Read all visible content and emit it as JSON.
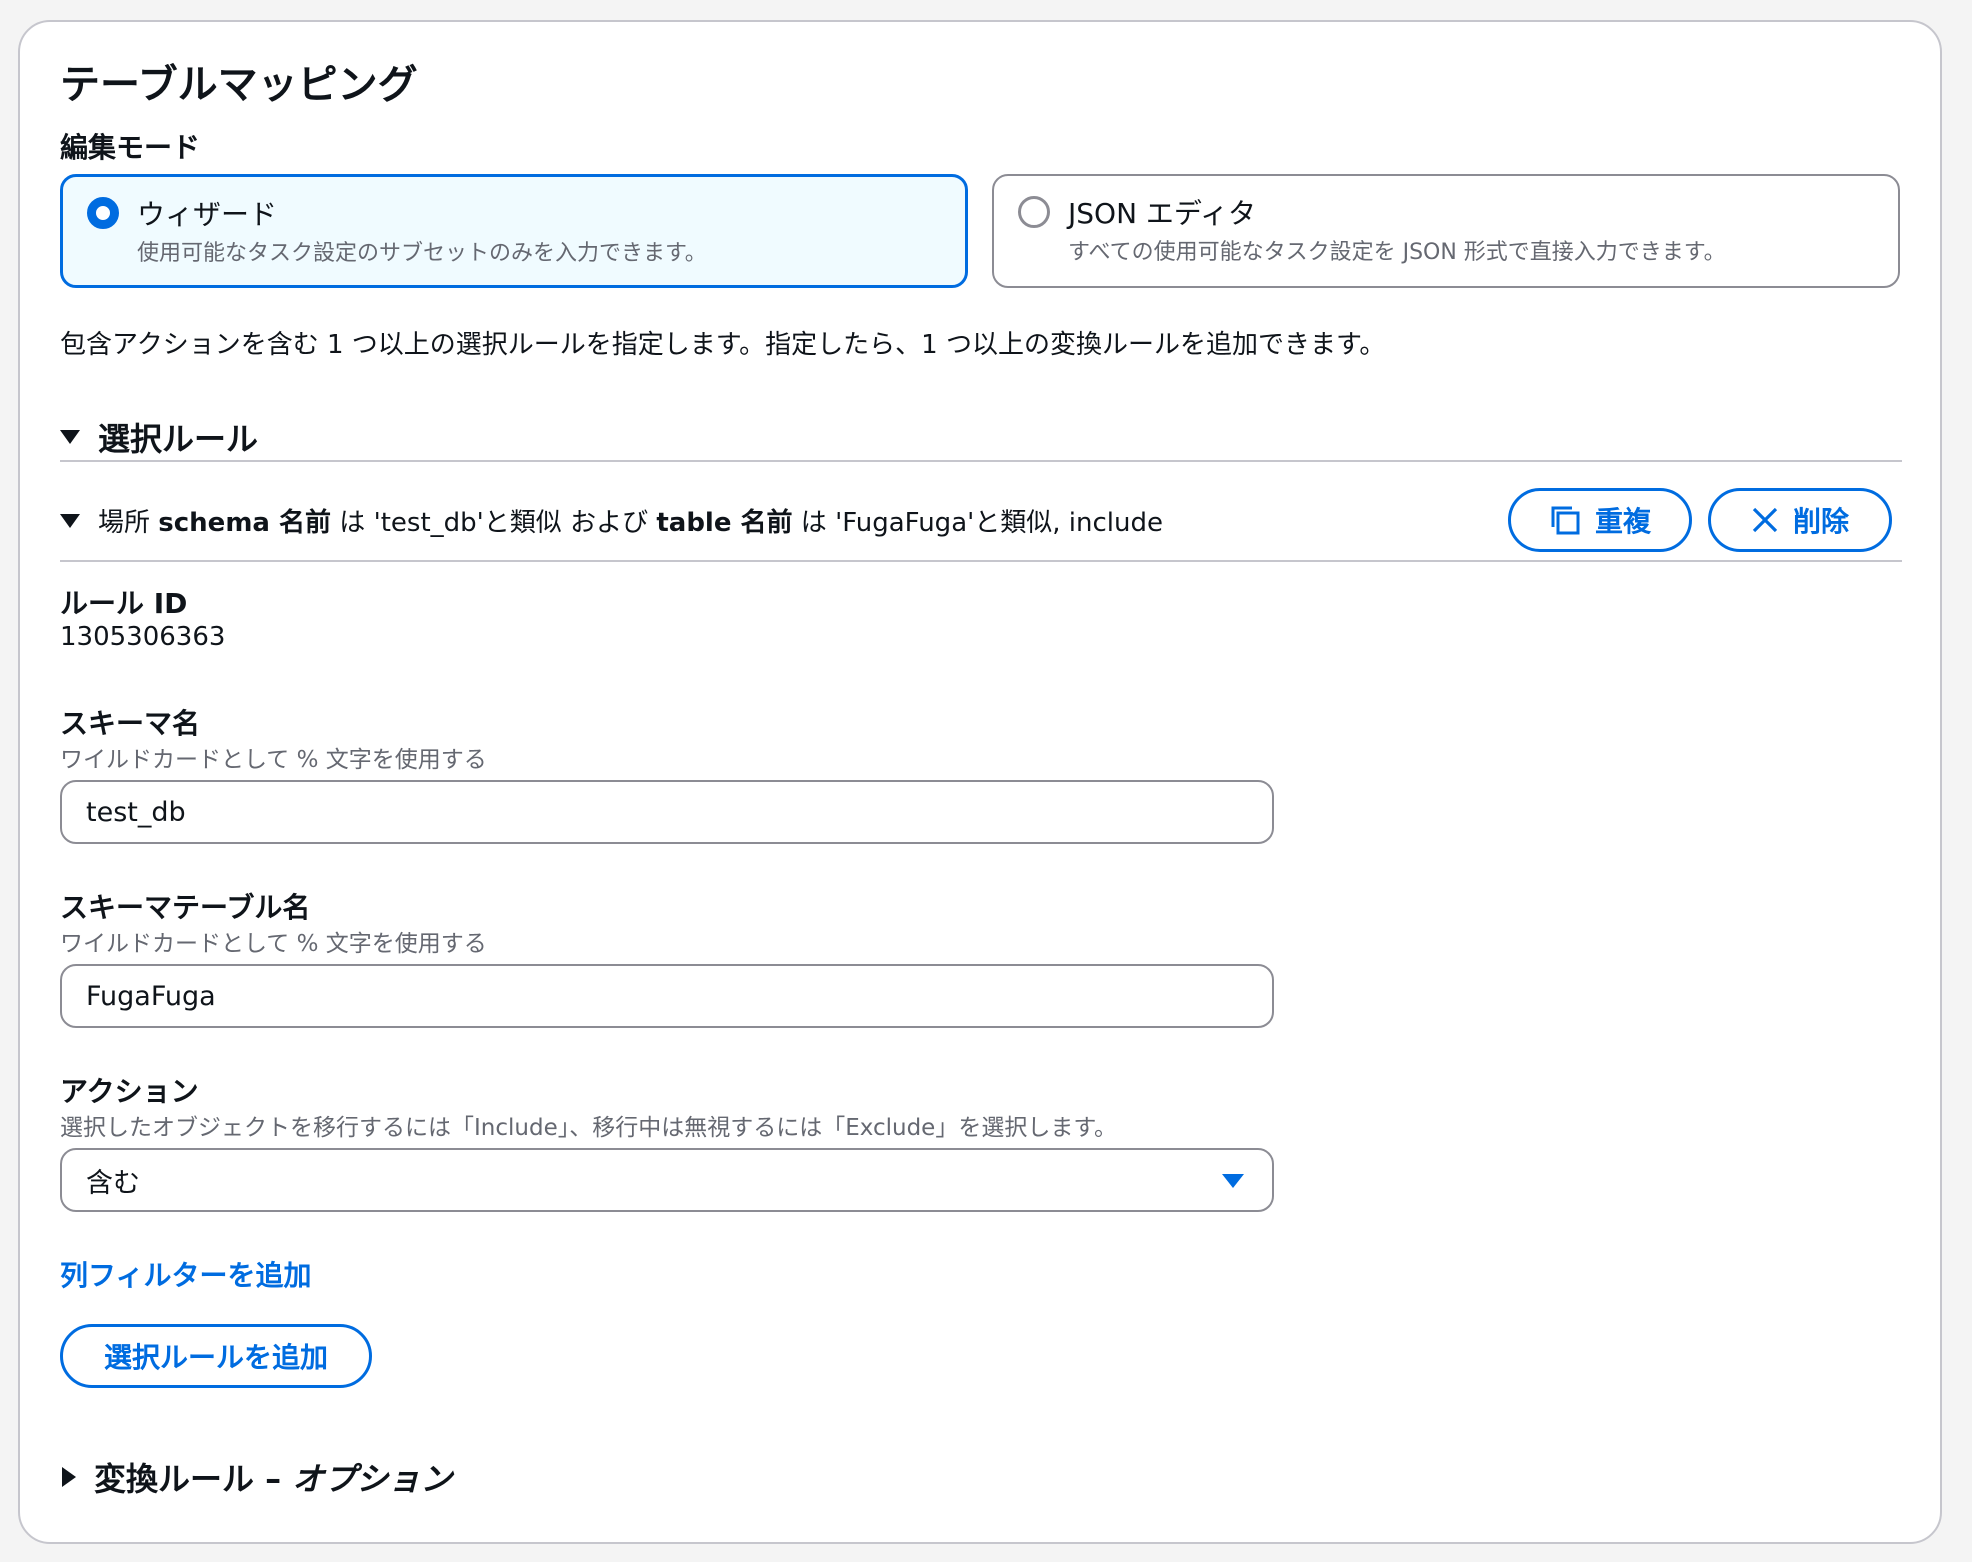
{
  "header": {
    "title": "テーブルマッピング"
  },
  "edit_mode": {
    "label": "編集モード",
    "options": [
      {
        "title": "ウィザード",
        "desc": "使用可能なタスク設定のサブセットのみを入力できます。",
        "selected": true
      },
      {
        "title": "JSON エディタ",
        "desc": "すべての使用可能なタスク設定を JSON 形式で直接入力できます。",
        "selected": false
      }
    ]
  },
  "intro_text": "包含アクションを含む 1 つ以上の選択ルールを指定します。指定したら、1 つ以上の変換ルールを追加できます。",
  "selection_rules": {
    "heading": "選択ルール",
    "rule": {
      "summary": {
        "prefix": "場所",
        "schema_word": "schema 名前",
        "is1": "は",
        "schema_value": "'test_db'と類似",
        "and": "および",
        "table_word": "table 名前",
        "is2": "は",
        "table_value": "'FugaFuga'と類似, include"
      },
      "duplicate_label": "重複",
      "delete_label": "削除",
      "rule_id_label": "ルール ID",
      "rule_id_value": "1305306363",
      "schema_name": {
        "label": "スキーマ名",
        "hint": "ワイルドカードとして % 文字を使用する",
        "value": "test_db"
      },
      "table_name": {
        "label": "スキーマテーブル名",
        "hint": "ワイルドカードとして % 文字を使用する",
        "value": "FugaFuga"
      },
      "action": {
        "label": "アクション",
        "hint": "選択したオブジェクトを移行するには「Include」、移行中は無視するには「Exclude」を選択します。",
        "value": "含む"
      },
      "add_column_filter": "列フィルターを追加"
    },
    "add_rule_button": "選択ルールを追加"
  },
  "transform_rules": {
    "heading": "変換ルール – ",
    "optional": "オプション"
  },
  "colors": {
    "accent": "#006ce0",
    "selected_bg": "#f0fbff",
    "border": "#8c8c94"
  }
}
